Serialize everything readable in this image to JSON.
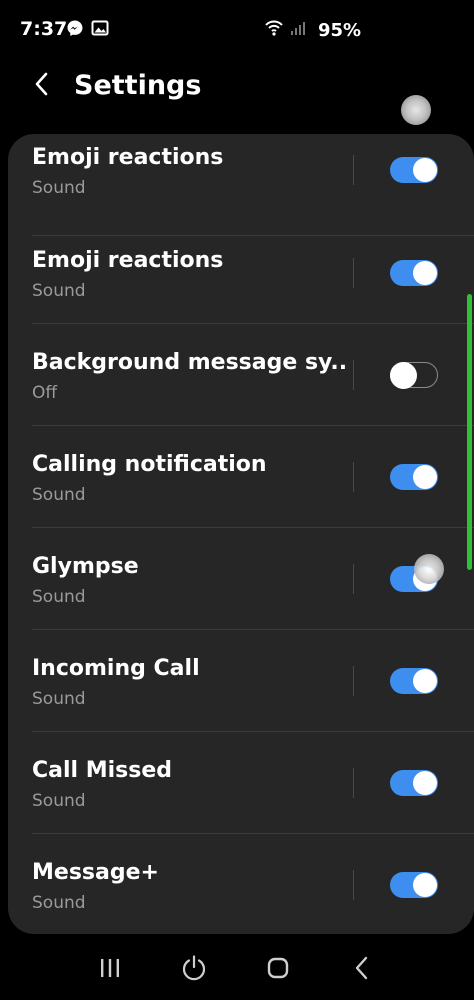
{
  "status_bar": {
    "time": "7:37",
    "battery": "95%",
    "icons": [
      "messenger-icon",
      "gallery-icon",
      "wifi-icon",
      "signal-icon"
    ]
  },
  "header": {
    "title": "Settings",
    "back_icon": "chevron-left-icon"
  },
  "settings": [
    {
      "title": "Emoji reactions",
      "subtitle": "Sound",
      "enabled": true
    },
    {
      "title": "Emoji reactions",
      "subtitle": "Sound",
      "enabled": true
    },
    {
      "title": "Background message sy..",
      "subtitle": "Off",
      "enabled": false
    },
    {
      "title": "Calling notification",
      "subtitle": "Sound",
      "enabled": true
    },
    {
      "title": "Glympse",
      "subtitle": "Sound",
      "enabled": true
    },
    {
      "title": "Incoming Call",
      "subtitle": "Sound",
      "enabled": true
    },
    {
      "title": "Call Missed",
      "subtitle": "Sound",
      "enabled": true
    },
    {
      "title": "Message+",
      "subtitle": "Sound",
      "enabled": true
    }
  ],
  "nav_bar": {
    "icons": [
      "recents-icon",
      "power-icon",
      "home-icon",
      "back-icon"
    ]
  },
  "colors": {
    "background": "#000000",
    "card": "#262626",
    "toggle_on": "#3e8ef0",
    "subtitle": "#9a9a9a",
    "scroll_indicator": "#2fc033"
  }
}
